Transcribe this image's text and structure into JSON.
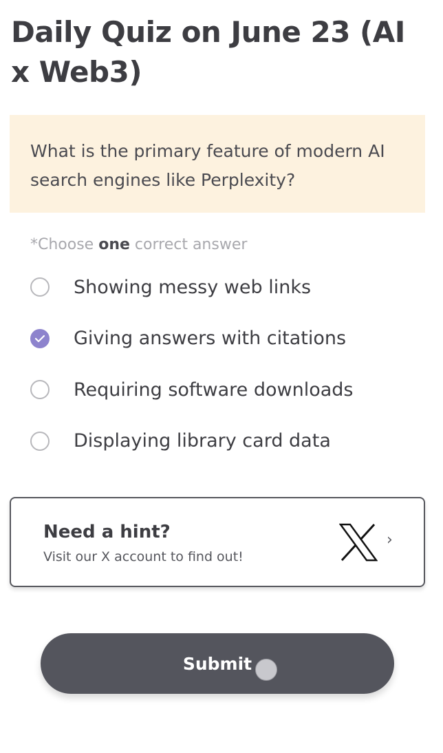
{
  "quiz": {
    "title": "Daily Quiz on June 23 (AI x Web3)",
    "question": "What is the primary feature of modern AI search engines like Perplexity?",
    "instruction": {
      "prefix": "*Choose ",
      "emphasis": "one",
      "suffix": " correct answer"
    },
    "options": [
      {
        "label": "Showing messy web links",
        "selected": false
      },
      {
        "label": "Giving answers with citations",
        "selected": true
      },
      {
        "label": "Requiring software downloads",
        "selected": false
      },
      {
        "label": "Displaying library card data",
        "selected": false
      }
    ]
  },
  "hint": {
    "title": "Need a hint?",
    "subtitle": "Visit our X account to find out!",
    "icon": "x-logo-icon",
    "chevron": "›"
  },
  "submit": {
    "label": "Submit"
  },
  "colors": {
    "question_bg": "#fdf2df",
    "radio_selected": "#8d83cd",
    "submit_bg": "#54555d"
  }
}
